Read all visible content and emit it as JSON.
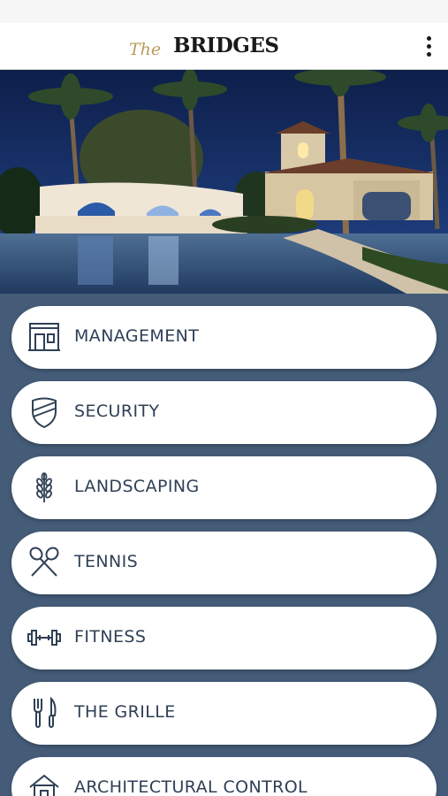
{
  "header": {
    "logo_prefix": "The",
    "logo_name": "BRIDGES",
    "menu_icon": "more-vert-icon"
  },
  "hero": {
    "description_icon": "clubhouse-photo"
  },
  "menu": {
    "items": [
      {
        "label": "MANAGEMENT",
        "icon": "storefront-icon"
      },
      {
        "label": "SECURITY",
        "icon": "shield-icon"
      },
      {
        "label": "LANDSCAPING",
        "icon": "wheat-icon"
      },
      {
        "label": "TENNIS",
        "icon": "tennis-rackets-icon"
      },
      {
        "label": "FITNESS",
        "icon": "dumbbell-icon"
      },
      {
        "label": "THE GRILLE",
        "icon": "fork-knife-icon"
      },
      {
        "label": "ARCHITECTURAL CONTROL",
        "icon": "house-icon"
      }
    ]
  },
  "colors": {
    "background": "#445c78",
    "button_text": "#2f4056",
    "icon_stroke": "#2f4056",
    "logo_gold": "#b89c5c"
  }
}
